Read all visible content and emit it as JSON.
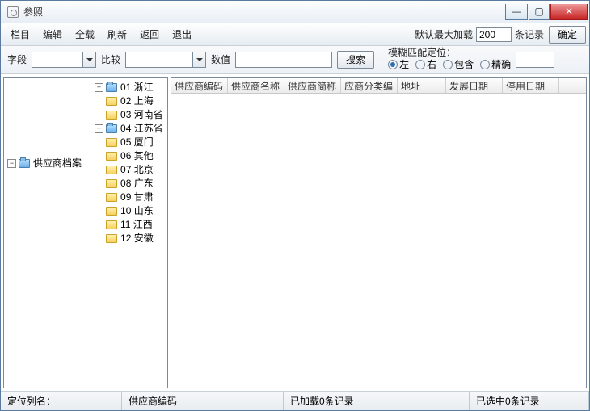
{
  "title": "参照",
  "menu": {
    "columns": "栏目",
    "edit": "编辑",
    "loadall": "全载",
    "refresh": "刷新",
    "back": "返回",
    "exit": "退出"
  },
  "load": {
    "label": "默认最大加载",
    "value": "200",
    "unit": "条记录",
    "ok": "确定"
  },
  "search": {
    "field_label": "字段",
    "compare_label": "比较",
    "value_label": "数值",
    "search_btn": "搜索",
    "fuzzy_label": "模糊匹配定位：",
    "opt_left": "左",
    "opt_right": "右",
    "opt_contain": "包含",
    "opt_exact": "精确"
  },
  "tree": {
    "root": "供应商档案",
    "items": [
      {
        "code": "01",
        "name": "浙江",
        "expandable": true
      },
      {
        "code": "02",
        "name": "上海",
        "expandable": false
      },
      {
        "code": "03",
        "name": "河南省",
        "expandable": false
      },
      {
        "code": "04",
        "name": "江苏省",
        "expandable": true
      },
      {
        "code": "05",
        "name": "厦门",
        "expandable": false
      },
      {
        "code": "06",
        "name": "其他",
        "expandable": false
      },
      {
        "code": "07",
        "name": "北京",
        "expandable": false
      },
      {
        "code": "08",
        "name": "广东",
        "expandable": false
      },
      {
        "code": "09",
        "name": "甘肃",
        "expandable": false
      },
      {
        "code": "10",
        "name": "山东",
        "expandable": false
      },
      {
        "code": "11",
        "name": "江西",
        "expandable": false
      },
      {
        "code": "12",
        "name": "安徽",
        "expandable": false
      }
    ]
  },
  "grid": {
    "columns": [
      "供应商编码",
      "供应商名称",
      "供应商简称",
      "应商分类编",
      "地址",
      "发展日期",
      "停用日期"
    ]
  },
  "status": {
    "locate": "定位列名：",
    "col": "供应商编码",
    "loaded": "已加载0条记录",
    "selected": "已选中0条记录"
  }
}
